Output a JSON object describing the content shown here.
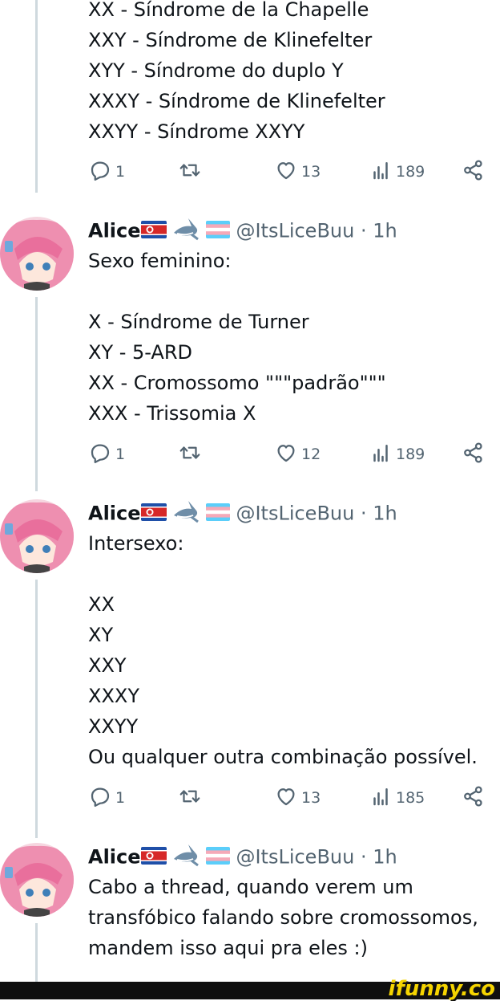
{
  "colors": {
    "text": "#0f1419",
    "secondary": "#536471",
    "thread_line": "#cfd9de",
    "brand": "#f5d400"
  },
  "posts": [
    {
      "continued": true,
      "lines": [
        "XX - Síndrome de la Chapelle",
        "XXY - Síndrome de Klinefelter",
        "XYY - Síndrome do duplo Y",
        "XXXY - Síndrome de Klinefelter",
        "XXYY - Síndrome XXYY"
      ],
      "actions": {
        "replies": "1",
        "retweets": "",
        "likes": "13",
        "views": "189"
      }
    },
    {
      "author": {
        "name": "Alice",
        "handle": "@ItsLiceBuu",
        "time": "· 1h",
        "badges": [
          "north-korea-flag",
          "shark-emoji",
          "transgender-flag"
        ]
      },
      "lines": [
        "Sexo feminino:",
        "",
        "X - Síndrome de Turner",
        "XY - 5-ARD",
        "XX - Cromossomo \"\"\"padrão\"\"\"",
        "XXX - Trissomia X"
      ],
      "actions": {
        "replies": "1",
        "retweets": "",
        "likes": "12",
        "views": "189"
      }
    },
    {
      "author": {
        "name": "Alice",
        "handle": "@ItsLiceBuu",
        "time": "· 1h",
        "badges": [
          "north-korea-flag",
          "shark-emoji",
          "transgender-flag"
        ]
      },
      "lines": [
        "Intersexo:",
        "",
        "XX",
        "XY",
        "XXY",
        "XXXY",
        "XXYY",
        "Ou qualquer outra combinação possível."
      ],
      "actions": {
        "replies": "1",
        "retweets": "",
        "likes": "13",
        "views": "185"
      }
    },
    {
      "author": {
        "name": "Alice",
        "handle": "@ItsLiceBuu",
        "time": "· 1h",
        "badges": [
          "north-korea-flag",
          "shark-emoji",
          "transgender-flag"
        ]
      },
      "lines": [
        "Cabo a thread, quando verem um",
        "transfóbico falando sobre cromossomos,",
        "mandem isso aqui pra eles :)"
      ]
    }
  ],
  "watermark": {
    "text": "ifunny.co"
  }
}
